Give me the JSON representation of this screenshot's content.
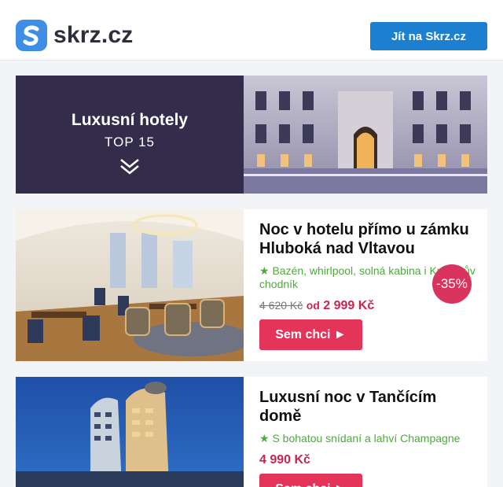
{
  "brand": {
    "name": "skrz.cz",
    "cta_label": "Jít na Skrz.cz"
  },
  "hero": {
    "title": "Luxusní hotely",
    "subtitle": "TOP 15"
  },
  "offers": [
    {
      "title": "Noc v hotelu přímo u zámku Hluboká nad Vltavou",
      "feature": "★ Bazén, whirlpool, solná kabina i Kneippův chodník",
      "old_price": "4 620 Kč",
      "from_label": "od",
      "price": "2 999 Kč",
      "discount": "-35%",
      "button_label": "Sem chci ►"
    },
    {
      "title": "Luxusní noc v Tančícím domě",
      "feature": "★ S bohatou snídaní a lahví Champagne",
      "price": "4 990 Kč",
      "button_label": "Sem chci ►"
    }
  ],
  "colors": {
    "brand_blue": "#1c7fd0",
    "hero_bg": "#332d4b",
    "accent_red": "#e4345a",
    "feature_green": "#4caa3a"
  }
}
